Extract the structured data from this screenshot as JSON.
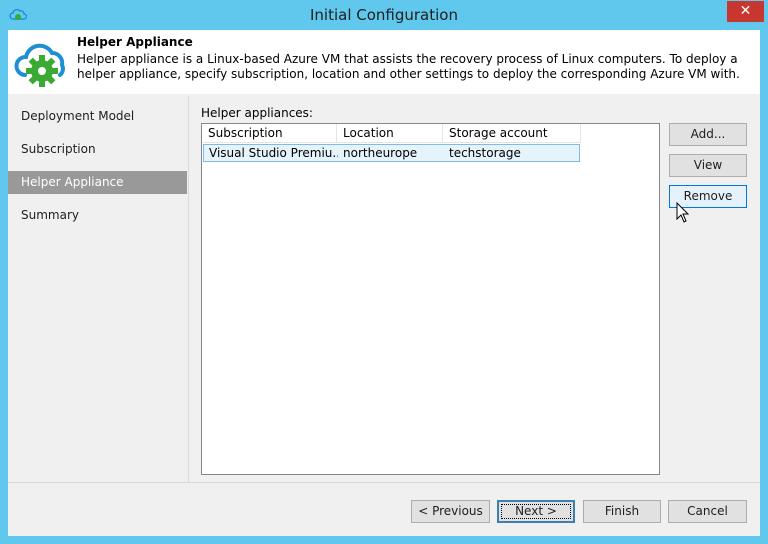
{
  "window": {
    "title": "Initial Configuration",
    "close_glyph": "✕"
  },
  "header": {
    "title": "Helper Appliance",
    "description": "Helper appliance is a Linux-based Azure VM that assists the recovery process of Linux computers. To deploy a helper appliance, specify subscription, location and other settings to deploy the corresponding Azure VM with."
  },
  "nav": {
    "items": [
      {
        "label": "Deployment Model"
      },
      {
        "label": "Subscription"
      },
      {
        "label": "Helper Appliance"
      },
      {
        "label": "Summary"
      }
    ],
    "active_index": 2
  },
  "content": {
    "list_label": "Helper appliances:",
    "columns": [
      "Subscription",
      "Location",
      "Storage account"
    ],
    "rows": [
      {
        "subscription": "Visual Studio Premiu...",
        "location": "northeurope",
        "storage": "techstorage"
      }
    ],
    "buttons": {
      "add": "Add...",
      "view": "View",
      "remove": "Remove"
    }
  },
  "footer": {
    "previous": "< Previous",
    "next": "Next >",
    "finish": "Finish",
    "cancel": "Cancel"
  },
  "colors": {
    "titlebar": "#5fc8ec",
    "close": "#c7372f",
    "selected_nav": "#999999",
    "selection_row": "#e5f3fb",
    "brand_green": "#3aaa35",
    "cloud_blue": "#1f8fd3"
  }
}
